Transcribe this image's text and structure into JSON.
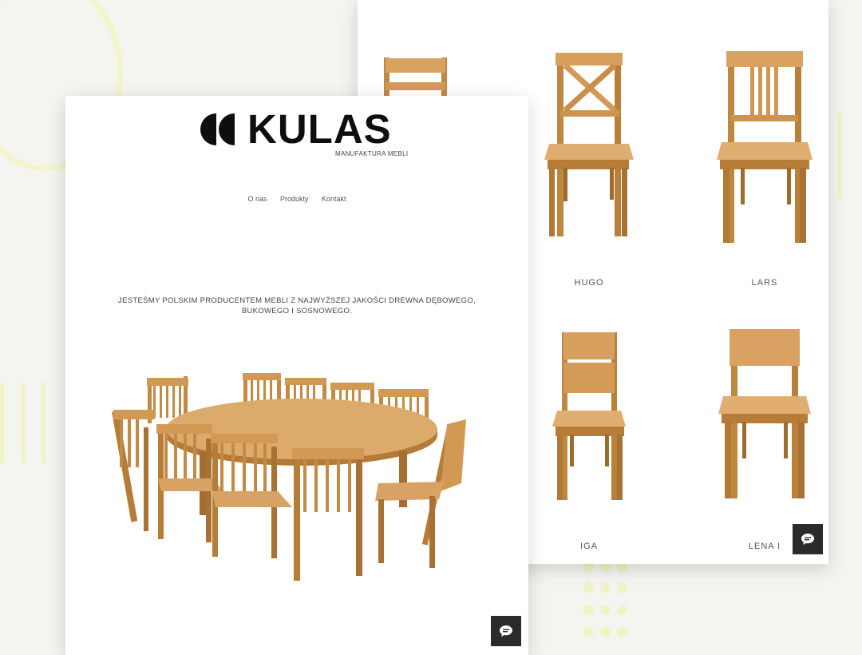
{
  "colors": {
    "accent_yellow": "#f1f3c4",
    "background": "#f4f5f0",
    "wood": "#c98e46",
    "chat_bg": "#2b2b2b"
  },
  "brand": {
    "name": "KULAS",
    "subtitle": "MANUFAKTURA MEBLI"
  },
  "nav": {
    "items": [
      "O nas",
      "Produkty",
      "Kontakt"
    ]
  },
  "hero": {
    "tagline": "JESTEŚMY POLSKIM PRODUCENTEM MEBLI Z NAJWYŻSZEJ JAKOŚCI DREWNA DĘBOWEGO, BUKOWEGO I SOSNOWEGO."
  },
  "products": [
    {
      "name": "HUGO"
    },
    {
      "name": "LARS"
    },
    {
      "name": "IGA"
    },
    {
      "name": "LENA I"
    }
  ],
  "icons": {
    "chat": "chat-bubble-icon",
    "logo": "kulas-logo-icon"
  }
}
